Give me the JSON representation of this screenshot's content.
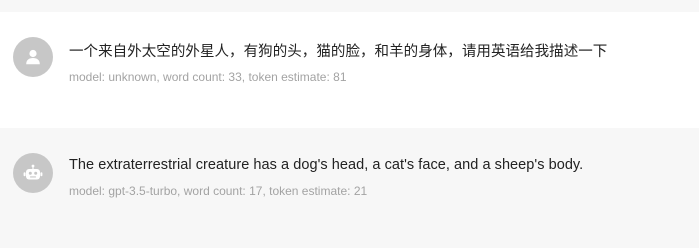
{
  "messages": [
    {
      "role": "user",
      "avatar_icon": "user-icon",
      "text": "一个来自外太空的外星人，有狗的头，猫的脸，和羊的身体，请用英语给我描述一下",
      "meta": "model: unknown, word count: 33, token estimate: 81"
    },
    {
      "role": "assistant",
      "avatar_icon": "robot-icon",
      "text": "The extraterrestrial creature has a dog's head, a cat's face, and a sheep's body.",
      "meta": "model: gpt-3.5-turbo, word count: 17, token estimate: 21"
    }
  ],
  "colors": {
    "avatar_bg": "#c7c7c7",
    "user_row_bg": "#ffffff",
    "bot_row_bg": "#f7f7f7",
    "text": "#222222",
    "meta": "#a3a3a3"
  }
}
